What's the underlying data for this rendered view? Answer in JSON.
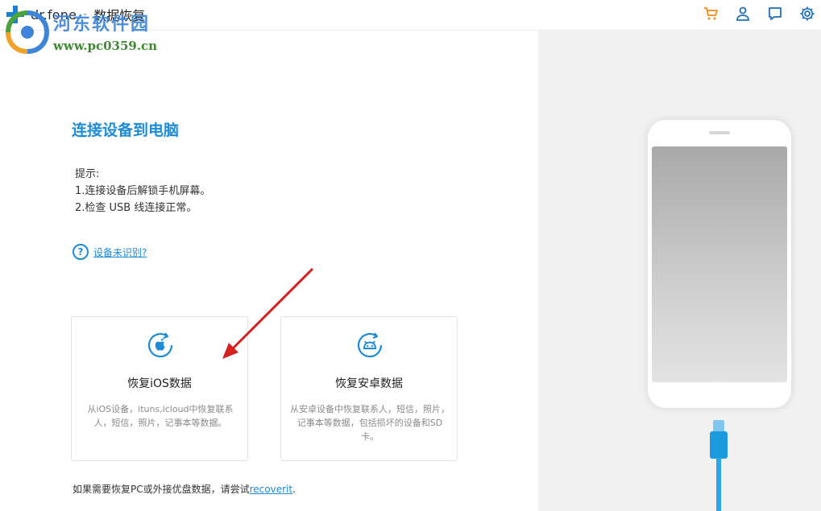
{
  "app": {
    "brand": "dr.fone",
    "separator": "-",
    "module": "数据恢复"
  },
  "toolbar": {
    "icons": [
      "cart-icon",
      "user-icon",
      "feedback-icon",
      "settings-icon"
    ],
    "accent": "#1d8bd6",
    "cart_color": "#f08c1c"
  },
  "watermark": {
    "title": "河东软件园",
    "url": "www.pc0359.cn"
  },
  "main": {
    "heading": "连接设备到电脑",
    "tips_title": "提示:",
    "tips": [
      "1.连接设备后解锁手机屏幕。",
      "2.检查 USB 线连接正常。"
    ],
    "help_link": "设备未识别?",
    "cards": [
      {
        "title": "恢复iOS数据",
        "desc": "从iOS设备，ituns,icloud中恢复联系人，短信，照片，记事本等数据。",
        "icon": "apple-icon"
      },
      {
        "title": "恢复安卓数据",
        "desc": "从安卓设备中恢复联系人，短信，照片，记事本等数据，包括损坏的设备和SD卡。",
        "icon": "android-icon"
      }
    ],
    "footer_prefix": "如果需要恢复PC或外接优盘数据，请尝试",
    "footer_link": "recoverit",
    "footer_suffix": "."
  }
}
